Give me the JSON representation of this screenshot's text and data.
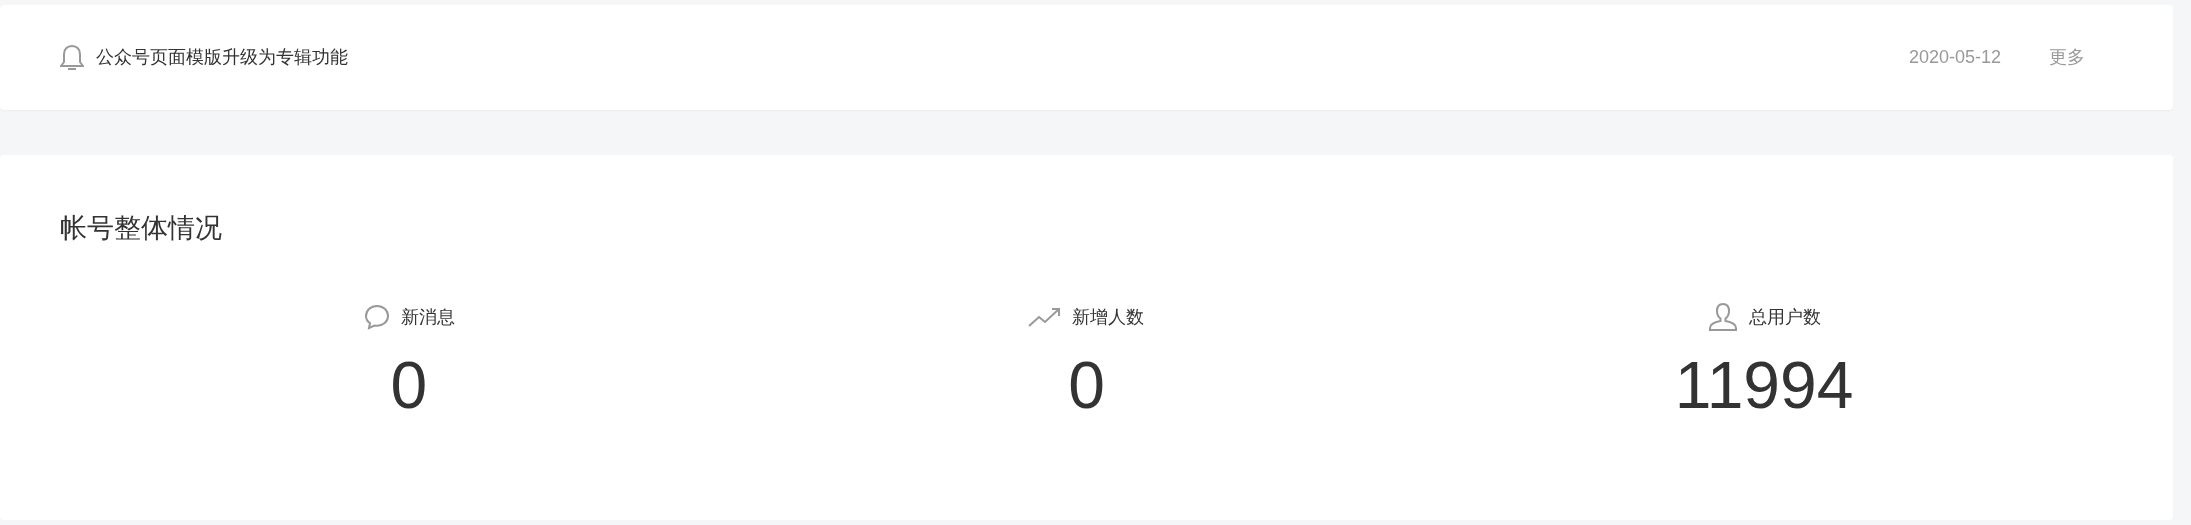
{
  "notice": {
    "text": "公众号页面模版升级为专辑功能",
    "date": "2020-05-12",
    "more": "更多"
  },
  "overview": {
    "title": "帐号整体情况",
    "stats": [
      {
        "kind": "message",
        "label": "新消息",
        "value": "0"
      },
      {
        "kind": "growth",
        "label": "新增人数",
        "value": "0"
      },
      {
        "kind": "users",
        "label": "总用户数",
        "value": "11994"
      }
    ]
  }
}
